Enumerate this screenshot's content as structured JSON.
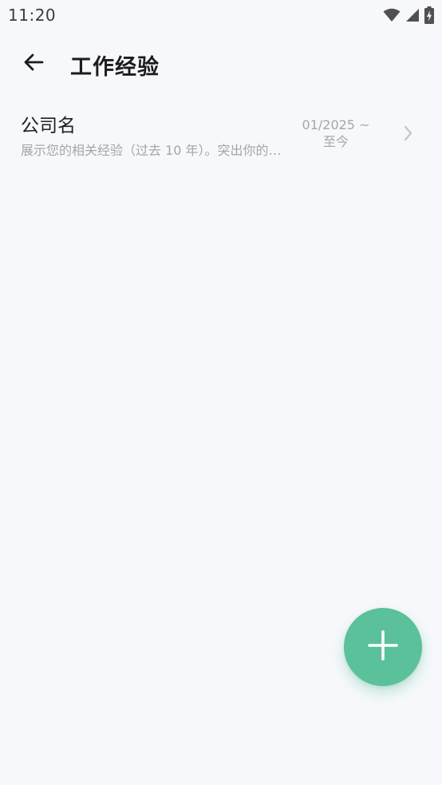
{
  "status_bar": {
    "time": "11:20",
    "icons": [
      "wifi-icon",
      "cellular-signal-icon",
      "battery-charging-icon"
    ]
  },
  "app_bar": {
    "back_icon": "arrow-left-icon",
    "title": "工作经验"
  },
  "experiences": [
    {
      "company": "公司名",
      "description": "展示您的相关经验（过去 10 年）。突出你的…",
      "date_range_start": "01/2025 ~",
      "date_range_end": "至今",
      "chevron_icon": "chevron-right-icon"
    }
  ],
  "fab": {
    "icon": "plus-icon",
    "color": "#5ac19b"
  },
  "colors": {
    "background": "#f7f8fc",
    "accent": "#5ac19b",
    "secondary_text": "#a6a6a6"
  }
}
